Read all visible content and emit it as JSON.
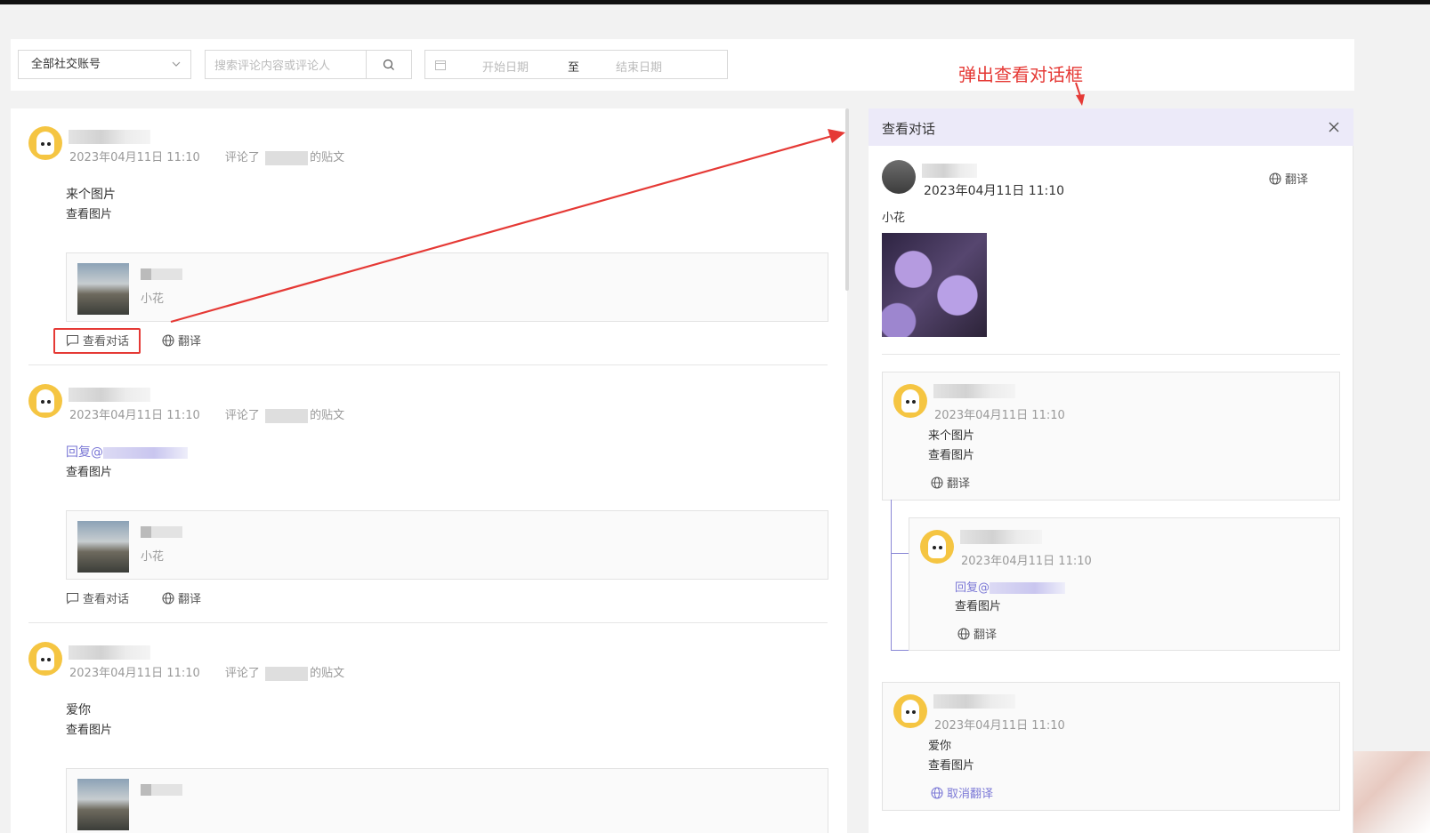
{
  "filters": {
    "account_select": "全部社交账号",
    "search_placeholder": "搜索评论内容或评论人",
    "date_start_placeholder": "开始日期",
    "date_separator": "至",
    "date_end_placeholder": "结束日期"
  },
  "feed": {
    "comments": [
      {
        "time": "2023年04月11日 11:10",
        "action": "评论了",
        "post_suffix": "的贴文",
        "text": "来个图片",
        "reply_prefix": "",
        "view_image": "查看图片",
        "post_text": "小花",
        "view_conversation": "查看对话",
        "translate": "翻译"
      },
      {
        "time": "2023年04月11日 11:10",
        "action": "评论了",
        "post_suffix": "的贴文",
        "text": "",
        "reply_prefix": "回复@",
        "view_image": "查看图片",
        "post_text": "小花",
        "view_conversation": "查看对话",
        "translate": "翻译"
      },
      {
        "time": "2023年04月11日 11:10",
        "action": "评论了",
        "post_suffix": "的贴文",
        "text": "爱你",
        "reply_prefix": "",
        "view_image": "查看图片"
      }
    ]
  },
  "annotation": "弹出查看对话框",
  "panel": {
    "title": "查看对话",
    "post": {
      "time": "2023年04月11日 11:10",
      "translate": "翻译",
      "text": "小花"
    },
    "replies": [
      {
        "time": "2023年04月11日 11:10",
        "text": "来个图片",
        "view_image": "查看图片",
        "translate": "翻译"
      },
      {
        "time": "2023年04月11日 11:10",
        "reply_prefix": "回复@",
        "view_image": "查看图片",
        "translate": "翻译"
      },
      {
        "time": "2023年04月11日 11:10",
        "text": "爱你",
        "view_image": "查看图片",
        "cancel_translate": "取消翻译"
      }
    ]
  },
  "colors": {
    "accent": "#7b78d6",
    "annotation": "#e53935",
    "panel_header": "#eceaf9"
  }
}
